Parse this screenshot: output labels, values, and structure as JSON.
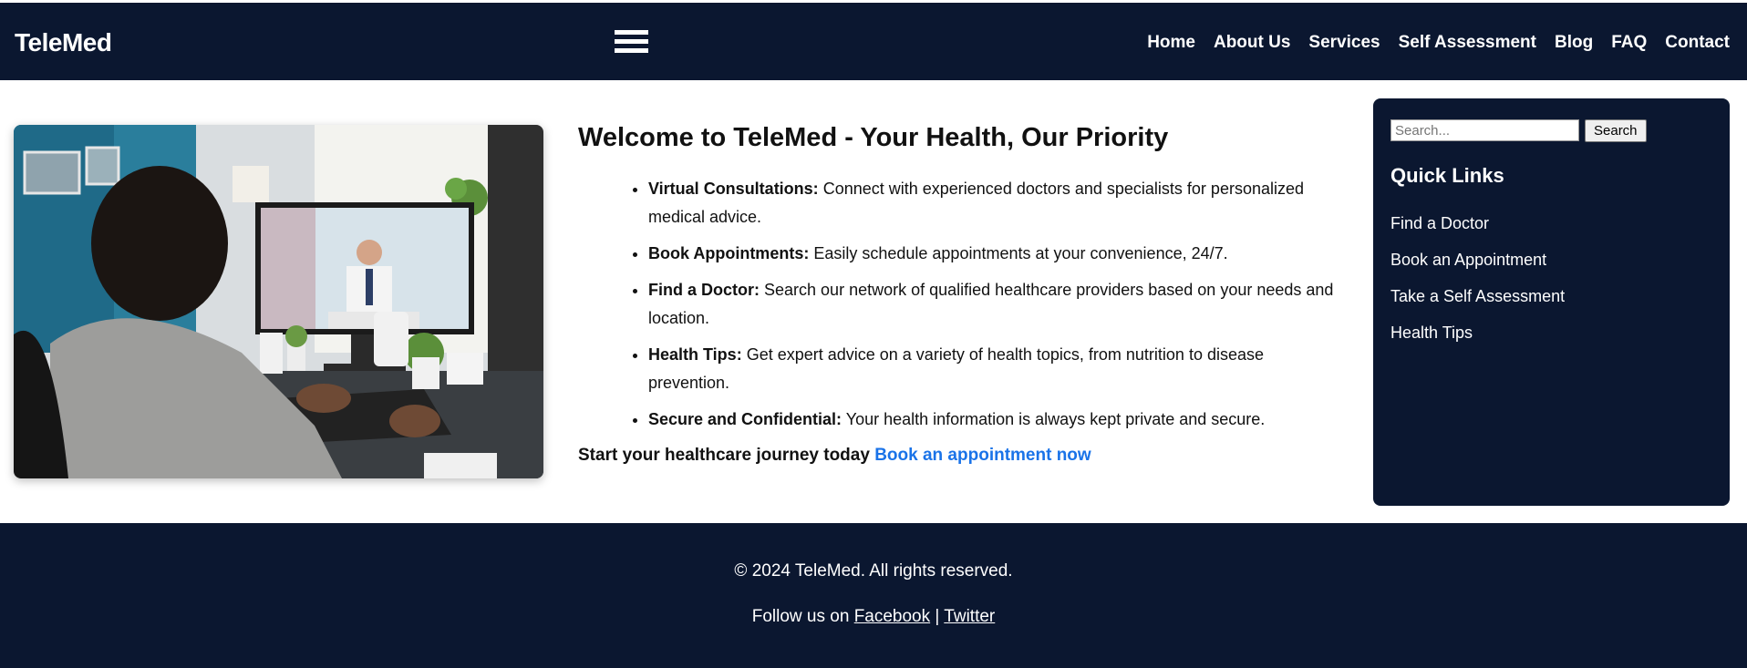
{
  "header": {
    "logo": "TeleMed",
    "nav": [
      "Home",
      "About Us",
      "Services",
      "Self Assessment",
      "Blog",
      "FAQ",
      "Contact"
    ]
  },
  "hero": {
    "image_alt": "Woman on a video consultation with a doctor"
  },
  "main": {
    "title": "Welcome to TeleMed - Your Health, Our Priority",
    "features": [
      {
        "label": "Virtual Consultations:",
        "text": "Connect with experienced doctors and specialists for personalized medical advice."
      },
      {
        "label": "Book Appointments:",
        "text": "Easily schedule appointments at your convenience, 24/7."
      },
      {
        "label": "Find a Doctor:",
        "text": "Search our network of qualified healthcare providers based on your needs and location."
      },
      {
        "label": "Health Tips:",
        "text": "Get expert advice on a variety of health topics, from nutrition to disease prevention."
      },
      {
        "label": "Secure and Confidential:",
        "text": "Your health information is always kept private and secure."
      }
    ],
    "cta_text": "Start your healthcare journey today",
    "cta_link": "Book an appointment now"
  },
  "sidebar": {
    "search_placeholder": "Search...",
    "search_button": "Search",
    "quick_links_title": "Quick Links",
    "quick_links": [
      "Find a Doctor",
      "Book an Appointment",
      "Take a Self Assessment",
      "Health Tips"
    ]
  },
  "footer": {
    "copyright": "© 2024 TeleMed. All rights reserved.",
    "follow_text": "Follow us on",
    "separator": "|",
    "social": [
      "Facebook",
      "Twitter"
    ]
  },
  "colors": {
    "navy": "#0b1730",
    "link_blue": "#1a73e8"
  }
}
